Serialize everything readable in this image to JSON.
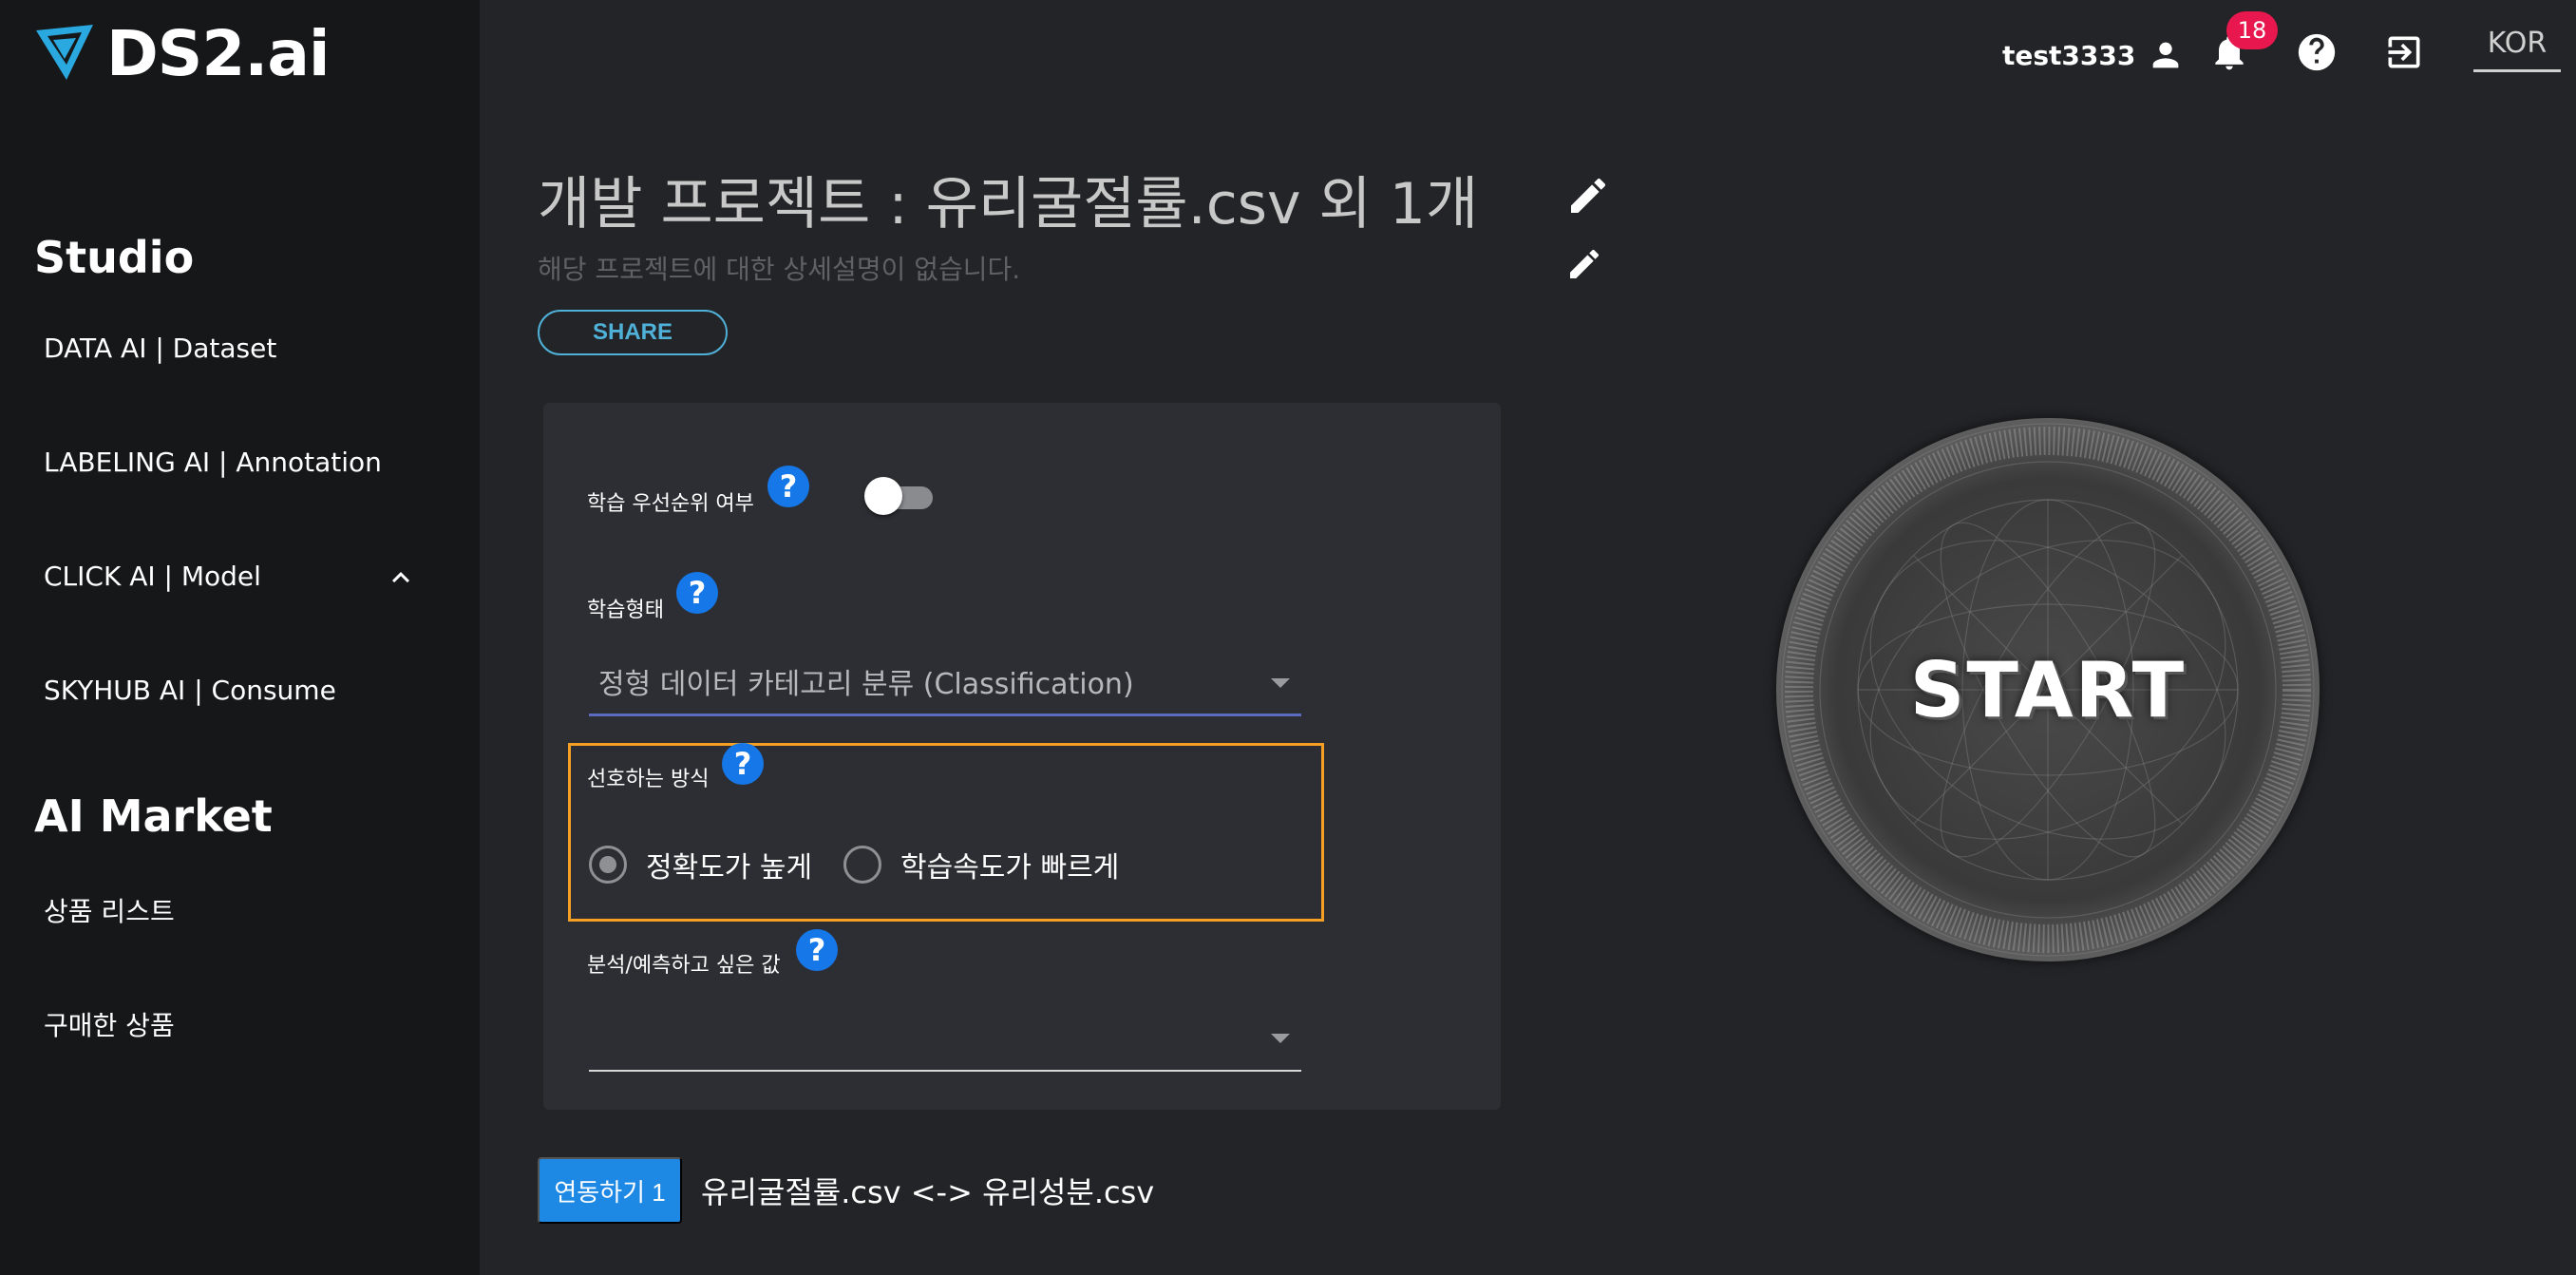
{
  "brand": {
    "name": "DS2.ai"
  },
  "sidebar": {
    "studio_title": "Studio",
    "studio_items": [
      {
        "label": "DATA AI | Dataset"
      },
      {
        "label": "LABELING AI | Annotation"
      },
      {
        "label": "CLICK AI | Model"
      },
      {
        "label": "SKYHUB AI | Consume"
      }
    ],
    "market_title": "AI Market",
    "market_items": [
      {
        "label": "상품 리스트"
      },
      {
        "label": "구매한 상품"
      }
    ]
  },
  "header": {
    "username": "test3333",
    "notification_count": "18",
    "language": "KOR"
  },
  "project": {
    "title": "개발 프로젝트 : 유리굴절률.csv 외 1개",
    "description": "해당 프로젝트에 대한 상세설명이 없습니다.",
    "share_label": "SHARE"
  },
  "form": {
    "priority_label": "학습 우선순위 여부",
    "priority_enabled": false,
    "training_type_label": "학습형태",
    "training_type_value": "정형 데이터 카테고리 분류 (Classification)",
    "preference_label": "선호하는 방식",
    "preference_options": [
      {
        "label": "정확도가 높게",
        "selected": true
      },
      {
        "label": "학습속도가 빠르게",
        "selected": false
      }
    ],
    "target_label": "분석/예측하고 싶은 값",
    "target_value": "",
    "help_symbol": "?"
  },
  "link": {
    "button_label": "연동하기 1",
    "description": "유리굴절률.csv <-> 유리성분.csv"
  },
  "start": {
    "label": "START"
  },
  "colors": {
    "accent_blue": "#1e88e5",
    "help_blue": "#1677e8",
    "highlight_orange": "#f5a023",
    "badge_red": "#e8174e",
    "share_cyan": "#4fb1d8"
  }
}
